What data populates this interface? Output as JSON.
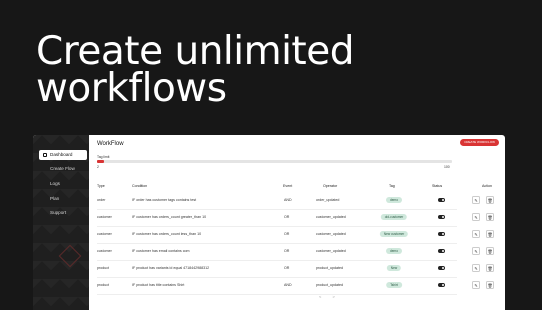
{
  "headline": {
    "line1": "Create unlimited",
    "line2": "workflows"
  },
  "sidebar": {
    "items": [
      {
        "label": "Dashboard",
        "active": true
      },
      {
        "label": "Create Flow",
        "active": false
      },
      {
        "label": "Logs",
        "active": false
      },
      {
        "label": "Plan",
        "active": false
      },
      {
        "label": "Support",
        "active": false
      }
    ]
  },
  "page": {
    "title": "WorkFlow",
    "create_button": "CREATE WORKFLOW",
    "limit_label": "Tag limit",
    "limit_min": "2",
    "limit_max": "100",
    "limit_fraction": 0.02
  },
  "table": {
    "headers": [
      "Type",
      "Condition",
      "Event",
      "Operator",
      "Tag",
      "Status",
      "Action"
    ],
    "rows": [
      {
        "type": "order",
        "condition": "IF order has customer tags contains test",
        "event": "AND",
        "operator": "order_updated",
        "tag": "demo",
        "status": "on"
      },
      {
        "type": "customer",
        "condition": "IF customer has orders_count greater_than 10",
        "event": "OR",
        "operator": "customer_updated",
        "tag": "old-customer",
        "status": "on"
      },
      {
        "type": "customer",
        "condition": "IF customer has orders_count less_than 10",
        "event": "OR",
        "operator": "customer_updated",
        "tag": "New customer",
        "status": "on"
      },
      {
        "type": "customer",
        "condition": "IF customer has email contains com",
        "event": "OR",
        "operator": "customer_updated",
        "tag": "demo",
        "status": "on"
      },
      {
        "type": "product",
        "condition": "IF product has variants id equal 4718442988312",
        "event": "OR",
        "operator": "product_updated",
        "tag": "New",
        "status": "on"
      },
      {
        "type": "product",
        "condition": "IF product has title contains Shirt",
        "event": "AND",
        "operator": "product_updated",
        "tag": "Tshirt",
        "status": "on"
      }
    ]
  },
  "pagination": {
    "prev": "<",
    "next": ">"
  },
  "colors": {
    "accent": "#d93434",
    "tag_bg": "#cfe8dc",
    "sidebar": "#1f1f1f"
  }
}
